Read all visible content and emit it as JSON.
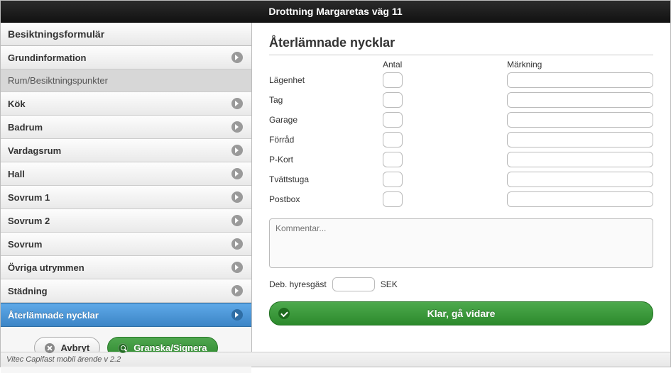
{
  "header": {
    "title": "Drottning Margaretas väg 11"
  },
  "sidebar": {
    "title": "Besiktningsformulär",
    "items": [
      {
        "label": "Grundinformation",
        "style": "normal",
        "chevron": true
      },
      {
        "label": "Rum/Besiktningspunkter",
        "style": "flat",
        "chevron": false
      },
      {
        "label": "Kök",
        "style": "normal",
        "chevron": true
      },
      {
        "label": "Badrum",
        "style": "normal",
        "chevron": true
      },
      {
        "label": "Vardagsrum",
        "style": "normal",
        "chevron": true
      },
      {
        "label": "Hall",
        "style": "normal",
        "chevron": true
      },
      {
        "label": "Sovrum 1",
        "style": "normal",
        "chevron": true
      },
      {
        "label": "Sovrum 2",
        "style": "normal",
        "chevron": true
      },
      {
        "label": "Sovrum",
        "style": "normal",
        "chevron": true
      },
      {
        "label": "Övriga utrymmen",
        "style": "normal",
        "chevron": true
      },
      {
        "label": "Städning",
        "style": "normal",
        "chevron": true
      },
      {
        "label": "Återlämnade nycklar",
        "style": "active",
        "chevron": true
      }
    ],
    "cancel_label": "Avbryt",
    "review_label": "Granska/Signera"
  },
  "main": {
    "title": "Återlämnade nycklar",
    "col_antal": "Antal",
    "col_mark": "Märkning",
    "rows": [
      {
        "label": "Lägenhet"
      },
      {
        "label": "Tag"
      },
      {
        "label": "Garage"
      },
      {
        "label": "Förråd"
      },
      {
        "label": "P-Kort"
      },
      {
        "label": "Tvättstuga"
      },
      {
        "label": "Postbox"
      }
    ],
    "comment_placeholder": "Kommentar...",
    "deb_label": "Deb. hyresgäst",
    "deb_unit": "SEK",
    "proceed_label": "Klar, gå vidare"
  },
  "footer": {
    "text": "Vitec Capifast mobil ärende v 2.2"
  }
}
